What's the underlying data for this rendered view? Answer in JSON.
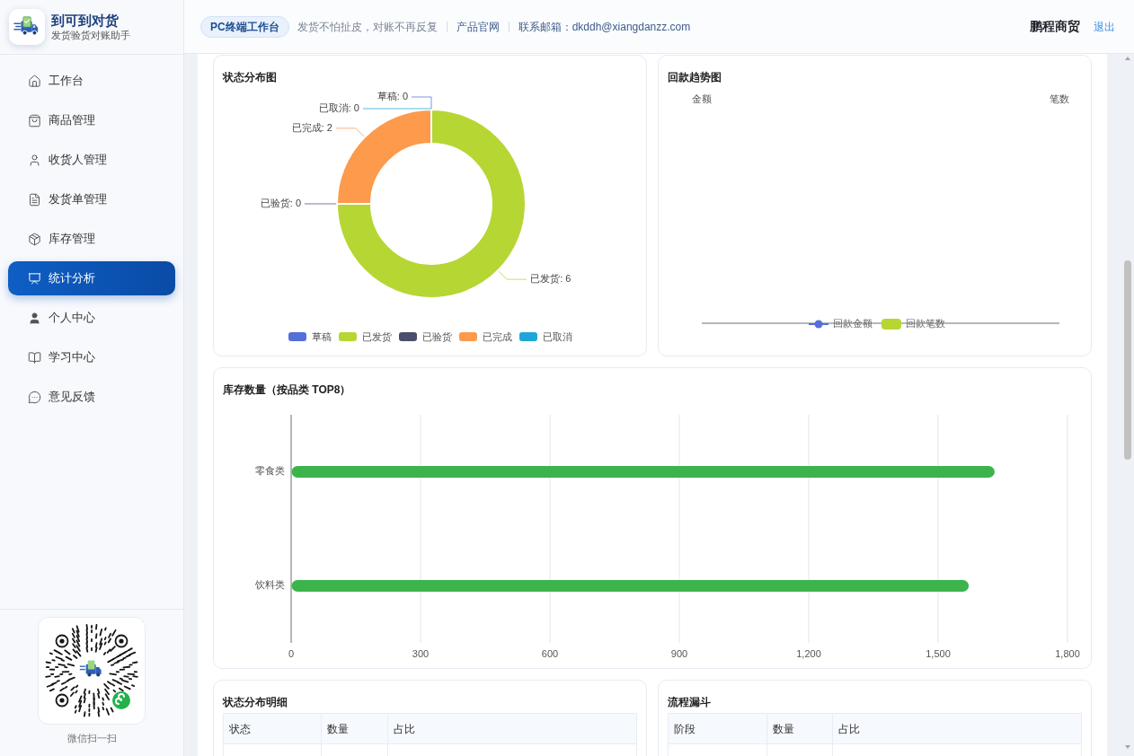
{
  "sidebar": {
    "brand": {
      "title": "到可到对货",
      "subtitle": "发货验货对账助手"
    },
    "nav": [
      {
        "label": "工作台",
        "selected": false
      },
      {
        "label": "商品管理",
        "selected": false
      },
      {
        "label": "收货人管理",
        "selected": false
      },
      {
        "label": "发货单管理",
        "selected": false
      },
      {
        "label": "库存管理",
        "selected": false
      },
      {
        "label": "统计分析",
        "selected": true
      },
      {
        "label": "个人中心",
        "selected": false
      },
      {
        "label": "学习中心",
        "selected": false
      },
      {
        "label": "意见反馈",
        "selected": false
      }
    ],
    "qr_caption": "微信扫一扫"
  },
  "header": {
    "badge": "PC终端工作台",
    "slogan": "发货不怕扯皮，对账不再反复",
    "links": [
      "产品官网",
      "联系邮箱：dkddh@xiangdanzz.com"
    ],
    "company": "鹏程商贸",
    "logout": "退出"
  },
  "status_chart": {
    "title": "状态分布图",
    "chart_data": {
      "type": "donut",
      "categories": [
        "草稿",
        "已发货",
        "已验货",
        "已完成",
        "已取消"
      ],
      "values": [
        0,
        6,
        0,
        2,
        0
      ],
      "colors": [
        "#5470d8",
        "#b6d634",
        "#4b4f6d",
        "#fd9a4b",
        "#1ea6da"
      ],
      "value_labels": [
        "草稿: 0",
        "已发货: 6",
        "已验货: 0",
        "已完成: 2",
        "已取消: 0"
      ]
    }
  },
  "payment_trend": {
    "title": "回款趋势图",
    "axis_names": [
      "金额",
      "笔数"
    ],
    "legend": [
      {
        "label": "回款金额",
        "color": "#5470d8",
        "kind": "line"
      },
      {
        "label": "回款笔数",
        "color": "#b6d634",
        "kind": "bar"
      }
    ]
  },
  "inventory_chart": {
    "title": "库存数量（按品类 TOP8）",
    "chart_data": {
      "type": "bar",
      "orientation": "horizontal",
      "grid": true,
      "categories": [
        "零食类",
        "饮料类"
      ],
      "series": [
        {
          "color": "#3cb44b",
          "values": [
            1630,
            1570
          ]
        }
      ],
      "xlim": [
        0,
        1800
      ],
      "xticks": [
        {
          "value": 0,
          "label": "0"
        },
        {
          "value": 300,
          "label": "300"
        },
        {
          "value": 600,
          "label": "600"
        },
        {
          "value": 900,
          "label": "900"
        },
        {
          "value": 1200,
          "label": "1,200"
        },
        {
          "value": 1500,
          "label": "1,500"
        },
        {
          "value": 1800,
          "label": "1,800"
        }
      ]
    }
  },
  "status_table": {
    "title": "状态分布明细",
    "columns": [
      "状态",
      "数量",
      "占比"
    ]
  },
  "funnel_table": {
    "title": "流程漏斗",
    "columns": [
      "阶段",
      "数量",
      "占比"
    ]
  }
}
